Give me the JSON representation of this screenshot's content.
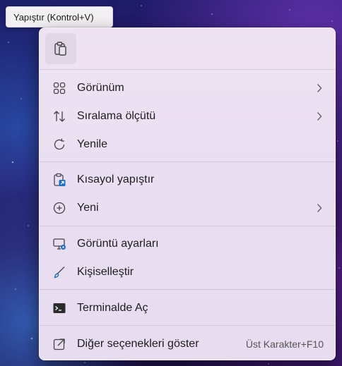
{
  "tooltip": {
    "text": "Yapıştır (Kontrol+V)"
  },
  "menu": {
    "quick_actions": [
      {
        "icon": "paste-icon"
      }
    ],
    "items": [
      {
        "label": "Görünüm",
        "icon": "grid-view-icon",
        "submenu": true
      },
      {
        "label": "Sıralama ölçütü",
        "icon": "sort-arrows-icon",
        "submenu": true
      },
      {
        "label": "Yenile",
        "icon": "refresh-icon",
        "submenu": false
      },
      {
        "label": "Kısayol yapıştır",
        "icon": "paste-shortcut-icon",
        "submenu": false
      },
      {
        "label": "Yeni",
        "icon": "add-circle-icon",
        "submenu": true
      },
      {
        "label": "Görüntü ayarları",
        "icon": "display-settings-icon",
        "submenu": false
      },
      {
        "label": "Kişiselleştir",
        "icon": "brush-icon",
        "submenu": false
      },
      {
        "label": "Terminalde Aç",
        "icon": "terminal-icon",
        "submenu": false
      },
      {
        "label": "Diğer seçenekleri göster",
        "icon": "open-external-icon",
        "submenu": false,
        "shortcut": "Üst Karakter+F10"
      }
    ]
  },
  "colors": {
    "accent": "#1f6fc1",
    "menu_bg": "#ebdff2"
  }
}
